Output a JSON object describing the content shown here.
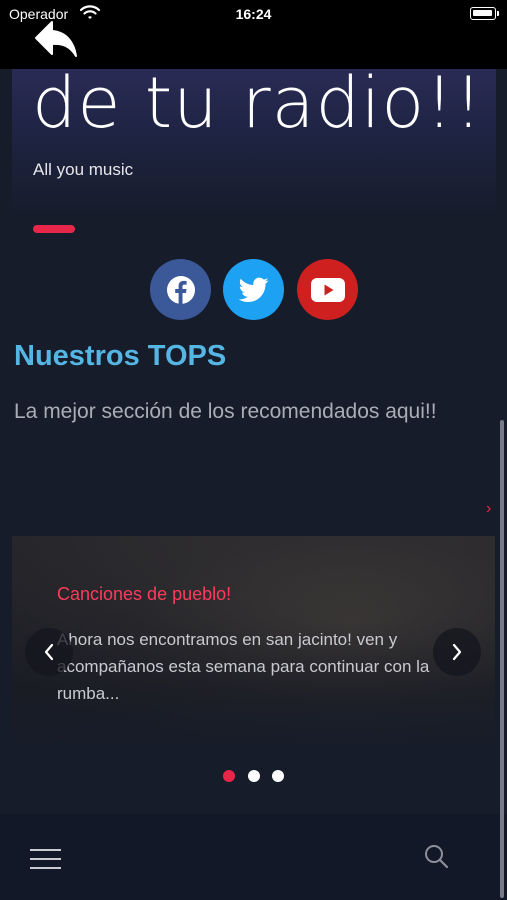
{
  "status_bar": {
    "carrier": "Operador",
    "time": "16:24"
  },
  "icons": {
    "back": "back-arrow-icon",
    "wifi": "wifi-icon",
    "battery": "battery-icon",
    "facebook": "facebook-icon",
    "twitter": "twitter-icon",
    "youtube": "youtube-icon",
    "menu": "hamburger-menu-icon",
    "search": "search-icon"
  },
  "hero": {
    "title": "de tu radio!!",
    "subtitle": "All you music"
  },
  "tops": {
    "title": "Nuestros TOPS",
    "subtitle": "La mejor sección de los recomendados aqui!!",
    "next_symbol": "›"
  },
  "carousel": {
    "active_index": 0,
    "slide_count": 3,
    "slide": {
      "title": "Canciones de pueblo!",
      "body": "Ahora nos encontramos en san jacinto! ven y acompañanos esta semana para continuar con la rumba..."
    }
  },
  "colors": {
    "accent": "#e8264a",
    "link_blue": "#55b6e3",
    "facebook": "#3b5998",
    "twitter": "#1da1f2",
    "youtube": "#cd201f",
    "dot_active": "#e8264a",
    "dot_inactive": "#ffffff"
  }
}
